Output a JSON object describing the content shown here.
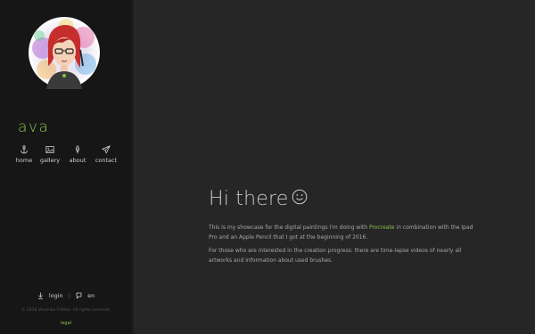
{
  "sidebar": {
    "brand": "ava",
    "nav": [
      {
        "label": "home",
        "icon": "anchor-icon"
      },
      {
        "label": "gallery",
        "icon": "image-icon"
      },
      {
        "label": "about",
        "icon": "feather-icon"
      },
      {
        "label": "contact",
        "icon": "paper-plane-icon"
      }
    ],
    "login_label": "login",
    "language_label": "en",
    "separator": "|",
    "copyright": "© 2016 Veronika Fröhler. All rights reserved.",
    "legal_label": "legal"
  },
  "main": {
    "greeting": "Hi there",
    "paragraph1": {
      "before": "This is my showcase for the digital paintings I'm doing with ",
      "link": "Procreate",
      "after": " in combination with the Ipad Pro and an Apple Pencil that I got at the beginning of 2016."
    },
    "paragraph2": "For those who are interested in the creation progress: there are time-lapse videos of nearly all artworks and information about used brushes."
  },
  "colors": {
    "accent": "#8bc34a",
    "sidebar_bg": "#161616",
    "main_bg": "#262626"
  }
}
